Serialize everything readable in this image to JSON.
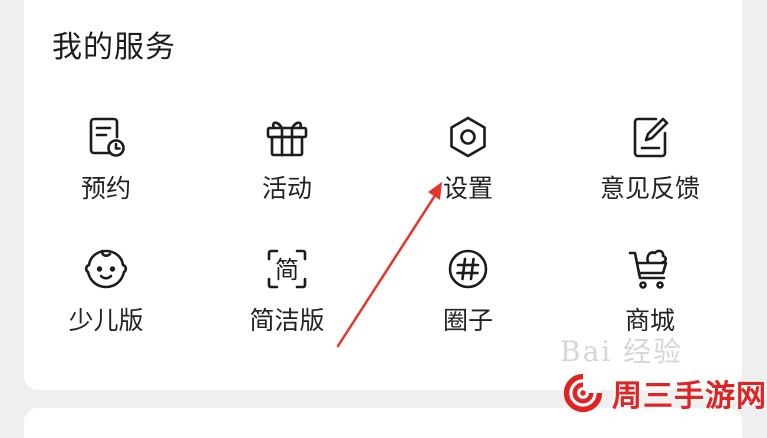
{
  "section": {
    "title": "我的服务",
    "items": [
      {
        "label": "预约",
        "icon": "calendar-clock-icon"
      },
      {
        "label": "活动",
        "icon": "gift-icon"
      },
      {
        "label": "设置",
        "icon": "settings-hexagon-icon"
      },
      {
        "label": "意见反馈",
        "icon": "feedback-edit-icon"
      },
      {
        "label": "少儿版",
        "icon": "child-face-icon"
      },
      {
        "label": "简洁版",
        "icon": "simple-mode-icon"
      },
      {
        "label": "圈子",
        "icon": "hashtag-circle-icon"
      },
      {
        "label": "商城",
        "icon": "shopping-cart-icon"
      }
    ]
  },
  "icon_glyphs": {
    "simple_mode": "简"
  },
  "overlay": {
    "watermark": "Bai 经验",
    "brand_name": "周三手游网",
    "arrow_color": "#e8322c"
  }
}
